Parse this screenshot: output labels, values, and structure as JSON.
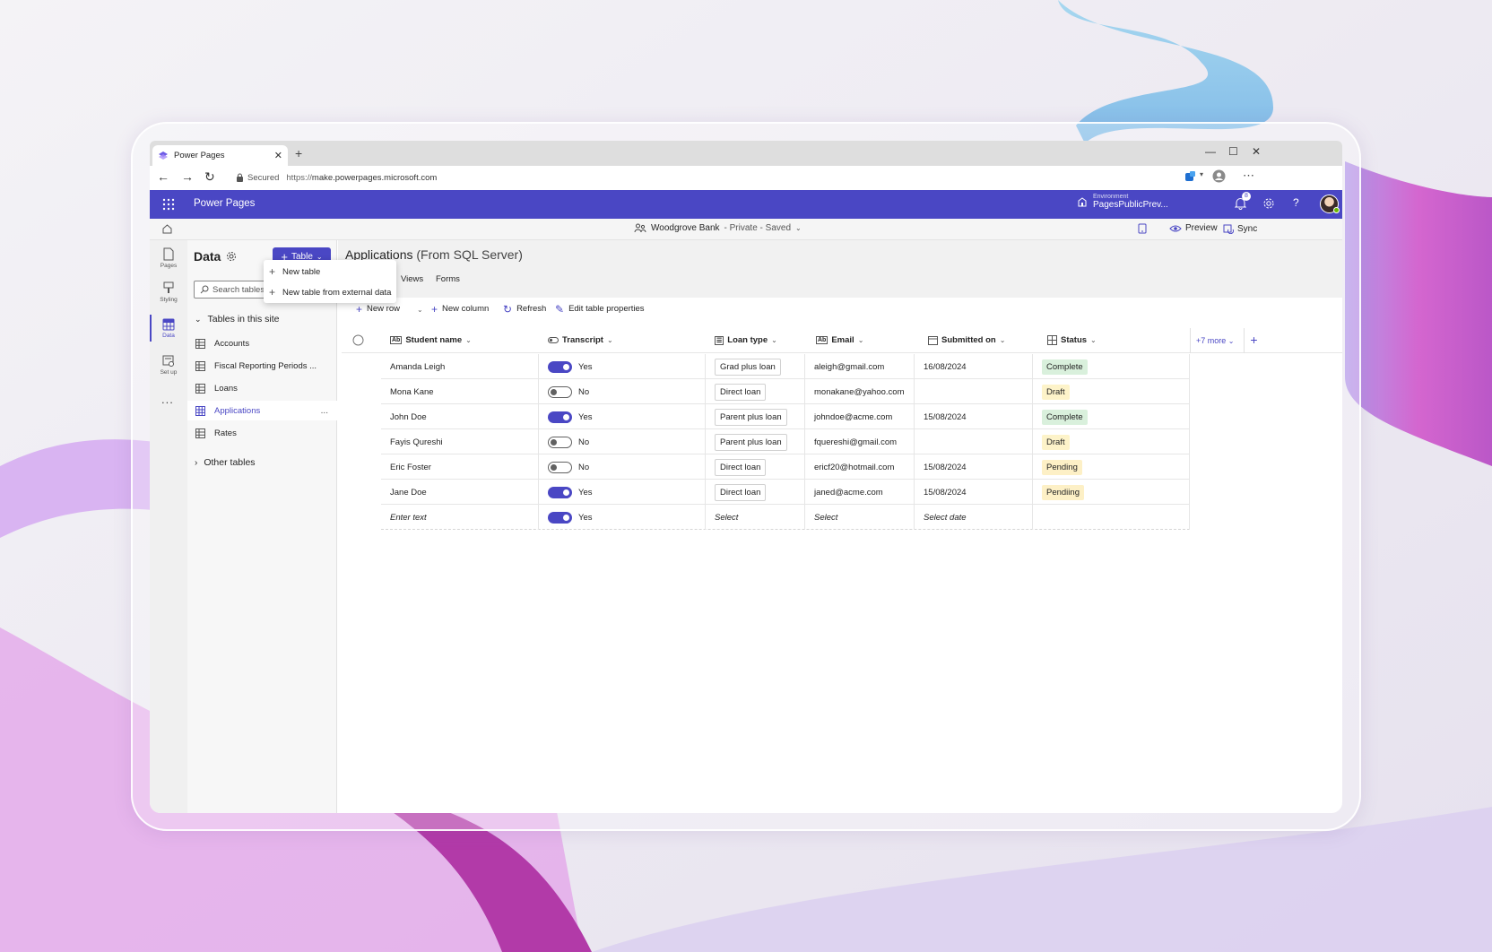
{
  "colors": {
    "brand": "#4a47c4",
    "complete_bg": "#d9f0dc",
    "draft_bg": "#fdf3c9",
    "pending_bg": "#fdf0c6"
  },
  "browser": {
    "tab_title": "Power Pages",
    "secured_label": "Secured",
    "url_prefix": "https://",
    "url": "make.powerpages.microsoft.com"
  },
  "header": {
    "app_name": "Power Pages",
    "environment_label": "Environment",
    "environment_value": "PagesPublicPrev...",
    "notification_count": "8"
  },
  "sitebar": {
    "site_name": "Woodgrove Bank",
    "site_status": "- Private - Saved",
    "preview_label": "Preview",
    "sync_label": "Sync"
  },
  "rail": {
    "items": [
      {
        "label": "Pages",
        "icon": "page-icon"
      },
      {
        "label": "Styling",
        "icon": "brush-icon"
      },
      {
        "label": "Data",
        "icon": "data-icon"
      },
      {
        "label": "Set up",
        "icon": "setup-icon"
      }
    ],
    "more": "..."
  },
  "panel": {
    "title": "Data",
    "table_button": "Table",
    "search_placeholder": "Search tables",
    "section_site": "Tables in this site",
    "tables": [
      "Accounts",
      "Fiscal Reporting Periods ...",
      "Loans",
      "Applications",
      "Rates"
    ],
    "active_table": "Applications",
    "section_other": "Other tables",
    "row_more": "..."
  },
  "menu": {
    "items": [
      "New table",
      "New table from external data"
    ]
  },
  "main": {
    "title": "Applications",
    "title_sub": "(From SQL Server)",
    "tabs": [
      "Views",
      "Forms"
    ],
    "toolbar": {
      "new_row": "New row",
      "new_column": "New column",
      "refresh": "Refresh",
      "edit_props": "Edit table properties"
    }
  },
  "grid": {
    "columns": [
      "Student name",
      "Transcript",
      "Loan type",
      "Email",
      "Submitted on",
      "Status"
    ],
    "more_columns": "+7 more",
    "rows": [
      {
        "name": "Amanda Leigh",
        "transcript": "Yes",
        "loan": "Grad plus loan",
        "email": "aleigh@gmail.com",
        "submitted": "16/08/2024",
        "status": "Complete"
      },
      {
        "name": "Mona Kane",
        "transcript": "No",
        "loan": "Direct loan",
        "email": "monakane@yahoo.com",
        "submitted": "",
        "status": "Draft"
      },
      {
        "name": "John Doe",
        "transcript": "Yes",
        "loan": "Parent plus loan",
        "email": "johndoe@acme.com",
        "submitted": "15/08/2024",
        "status": "Complete"
      },
      {
        "name": "Fayis Qureshi",
        "transcript": "No",
        "loan": "Parent plus loan",
        "email": "fquereshi@gmail.com",
        "submitted": "",
        "status": "Draft"
      },
      {
        "name": "Eric Foster",
        "transcript": "No",
        "loan": "Direct loan",
        "email": "ericf20@hotmail.com",
        "submitted": "15/08/2024",
        "status": "Pending"
      },
      {
        "name": "Jane Doe",
        "transcript": "Yes",
        "loan": "Direct loan",
        "email": "janed@acme.com",
        "submitted": "15/08/2024",
        "status": "Pendiing"
      }
    ],
    "entry_row": {
      "name": "Enter text",
      "transcript": "Yes",
      "loan": "Select",
      "email": "Select",
      "submitted": "Select date"
    }
  }
}
